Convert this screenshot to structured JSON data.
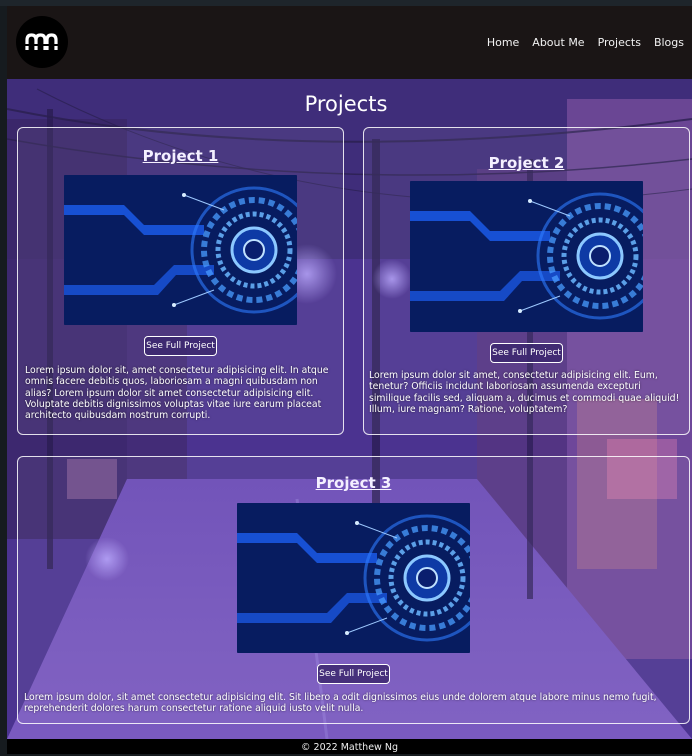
{
  "brand": {
    "logo_text": "mn"
  },
  "nav": {
    "items": [
      {
        "label": "Home"
      },
      {
        "label": "About Me"
      },
      {
        "label": "Projects"
      },
      {
        "label": "Blogs"
      }
    ]
  },
  "main": {
    "heading": "Projects",
    "projects": [
      {
        "title": "Project 1",
        "button": "See Full Project",
        "description": "Lorem ipsum dolor sit, amet consectetur adipisicing elit. In atque omnis facere debitis quos, laboriosam a magni quibusdam non alias? Lorem ipsum dolor sit amet consectetur adipisicing elit. Voluptate debitis dignissimos voluptas vitae iure earum placeat architecto quibusdam nostrum corrupti."
      },
      {
        "title": "Project 2",
        "button": "See Full Project",
        "description": "Lorem ipsum dolor sit amet, consectetur adipisicing elit. Eum, tenetur? Officiis incidunt laboriosam assumenda excepturi similique facilis sed, aliquam a, ducimus et commodi quae aliquid! Illum, iure magnam? Ratione, voluptatem?"
      },
      {
        "title": "Project 3",
        "button": "See Full Project",
        "description": "Lorem ipsum dolor, sit amet consectetur adipisicing elit. Sit libero a odit dignissimos eius unde dolorem atque labore minus nemo fugit, reprehenderit dolores harum consectetur ratione aliquid iusto velit nulla."
      }
    ]
  },
  "footer": {
    "text": "© 2022 Matthew Ng"
  },
  "colors": {
    "navbar": "#1a1515",
    "accent": "#2f7bff",
    "scene": "#4a2f8c"
  }
}
